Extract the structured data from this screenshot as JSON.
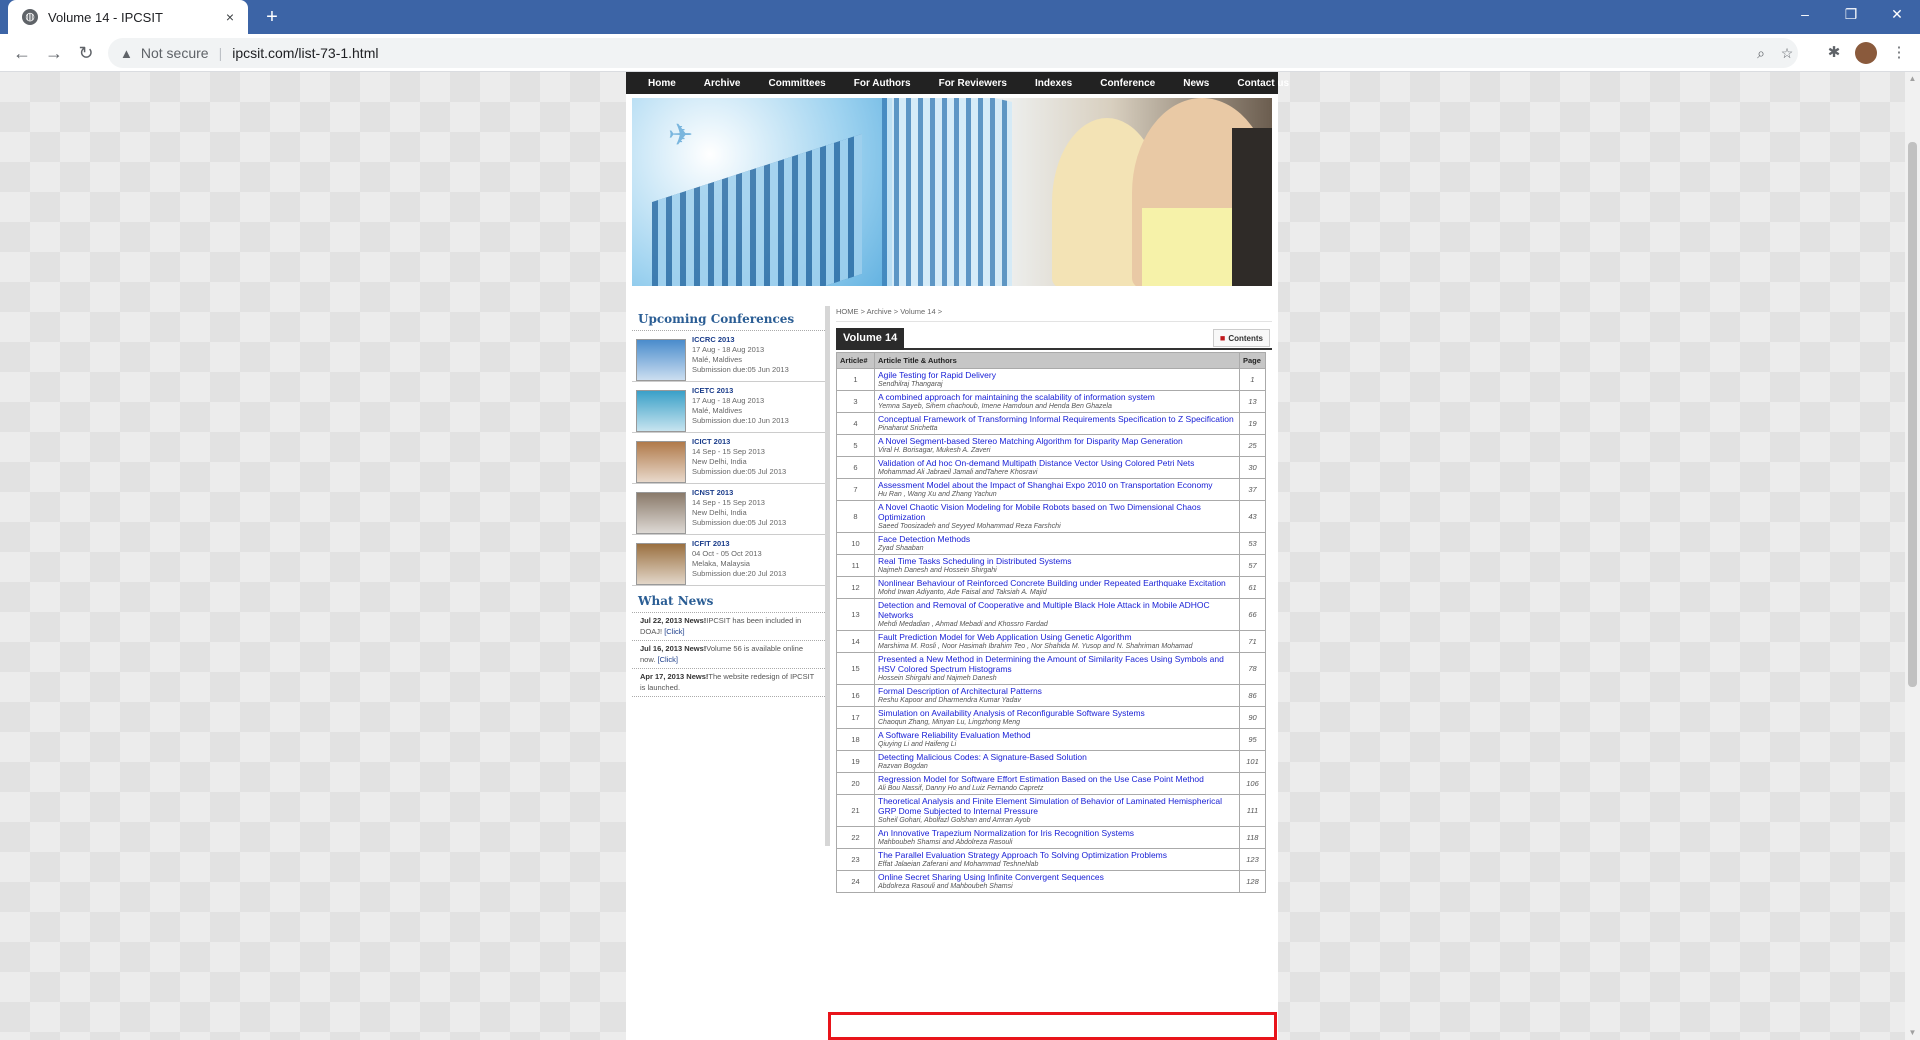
{
  "browser": {
    "tab_title": "Volume 14 - IPCSIT",
    "tab_close": "×",
    "new_tab": "+",
    "security_label": "Not secure",
    "url": "ipcsit.com/list-73-1.html",
    "window_controls": [
      "–",
      "❐",
      "✕"
    ]
  },
  "site": {
    "nav": [
      "Home",
      "Archive",
      "Committees",
      "For Authors",
      "For Reviewers",
      "Indexes",
      "Conference",
      "News",
      "Contact us"
    ]
  },
  "sidebar": {
    "upcoming_title": "Upcoming Conferences",
    "conferences": [
      {
        "name": "ICCRC 2013",
        "dates": "17 Aug - 18 Aug 2013",
        "location": "Malé, Maldives",
        "due": "Submission due:05 Jun 2013",
        "thumb_color": "#4a8ccc"
      },
      {
        "name": "ICETC 2013",
        "dates": "17 Aug - 18 Aug 2013",
        "location": "Malé, Maldives",
        "due": "Submission due:10 Jun 2013",
        "thumb_color": "#3aa0c8"
      },
      {
        "name": "ICICT 2013",
        "dates": "14 Sep - 15 Sep 2013",
        "location": "New Delhi, India",
        "due": "Submission due:05 Jul 2013",
        "thumb_color": "#b07a4a"
      },
      {
        "name": "ICNST 2013",
        "dates": "14 Sep - 15 Sep 2013",
        "location": "New Delhi, India",
        "due": "Submission due:05 Jul 2013",
        "thumb_color": "#8a7a6a"
      },
      {
        "name": "ICFIT 2013",
        "dates": "04 Oct - 05 Oct 2013",
        "location": "Melaka, Malaysia",
        "due": "Submission due:20 Jul 2013",
        "thumb_color": "#9a7040"
      }
    ],
    "news_title": "What News",
    "news": [
      {
        "date": "Jul 22, 2013 News!",
        "text": "IPCSIT has been included in DOAJ!",
        "link": "[Click]"
      },
      {
        "date": "Jul 16, 2013 News!",
        "text": "Volume 56 is available online now.",
        "link": "[Click]"
      },
      {
        "date": "Apr 17, 2013 News!",
        "text": "The website redesign of IPCSIT is launched.",
        "link": ""
      }
    ]
  },
  "main": {
    "breadcrumb": "HOME > Archive > Volume 14 >",
    "volume_title": "Volume 14",
    "contents_label": "Contents",
    "table_headers": {
      "num": "Article#",
      "title": "Article Title & Authors",
      "page": "Page"
    },
    "articles": [
      {
        "num": "1",
        "title": "Agile Testing for Rapid Delivery",
        "authors": "Sendhilraj Thangaraj",
        "page": "1"
      },
      {
        "num": "3",
        "title": "A combined approach for maintaining the scalability of information system",
        "authors": "Yemna Sayeb, Sihem chachoub, Imene Hamdoun and Henda Ben Ghazela",
        "page": "13"
      },
      {
        "num": "4",
        "title": "Conceptual Framework of Transforming Informal Requirements Specification to Z Specification",
        "authors": "Pinaharut Srichetta",
        "page": "19"
      },
      {
        "num": "5",
        "title": "A Novel Segment-based Stereo Matching Algorithm for Disparity Map Generation",
        "authors": "Viral H. Borisagar, Mukesh A. Zaveri",
        "page": "25"
      },
      {
        "num": "6",
        "title": "Validation of Ad hoc On-demand Multipath Distance Vector Using Colored Petri Nets",
        "authors": "Mohammad Ali Jabraeil Jamali andTahere Khosravi",
        "page": "30"
      },
      {
        "num": "7",
        "title": "Assessment Model about the Impact of Shanghai Expo 2010 on Transportation Economy",
        "authors": "Hu Ran , Wang Xu and Zhang Yachun",
        "page": "37"
      },
      {
        "num": "8",
        "title": "A Novel Chaotic Vision Modeling for Mobile Robots based on Two Dimensional Chaos Optimization",
        "authors": "Saeed Toosizadeh and Seyyed Mohammad Reza Farshchi",
        "page": "43"
      },
      {
        "num": "10",
        "title": "Face Detection Methods",
        "authors": "Zyad Shaaban",
        "page": "53"
      },
      {
        "num": "11",
        "title": "Real Time Tasks Scheduling in Distributed Systems",
        "authors": "Najmeh Danesh and Hossein Shirgahi",
        "page": "57"
      },
      {
        "num": "12",
        "title": "Nonlinear Behaviour of Reinforced Concrete Building under Repeated Earthquake Excitation",
        "authors": "Mohd Irwan Adiyanto, Ade Faisal and Taksiah A. Majid",
        "page": "61"
      },
      {
        "num": "13",
        "title": "Detection and Removal of Cooperative and Multiple Black Hole Attack in Mobile ADHOC Networks",
        "authors": "Mehdi Medadian , Ahmad Mebadi and Khossro Fardad",
        "page": "66"
      },
      {
        "num": "14",
        "title": "Fault Prediction Model for Web Application Using Genetic Algorithm",
        "authors": "Marshima M. Rosli , Noor Hasimah Ibrahim Teo , Nor Shahida M. Yusop and N. Shahriman Mohamad",
        "page": "71"
      },
      {
        "num": "15",
        "title": "Presented a New Method in Determining the Amount of Similarity Faces Using Symbols and HSV Colored Spectrum Histograms",
        "authors": "Hossein Shirgahi and Najmeh Danesh",
        "page": "78"
      },
      {
        "num": "16",
        "title": "Formal Description of Architectural Patterns",
        "authors": "Reshu Kapoor and Dharmendra Kumar Yadav",
        "page": "86"
      },
      {
        "num": "17",
        "title": "Simulation on Availability Analysis of Reconfigurable Software Systems",
        "authors": "Chaoqun Zhang, Minyan Lu, Lingzhong Meng",
        "page": "90"
      },
      {
        "num": "18",
        "title": "A Software Reliability Evaluation Method",
        "authors": "Qiuying Li and Haifeng Li",
        "page": "95"
      },
      {
        "num": "19",
        "title": "Detecting Malicious Codes: A Signature-Based Solution",
        "authors": "Razvan Bogdan",
        "page": "101"
      },
      {
        "num": "20",
        "title": "Regression Model for Software Effort Estimation Based on the Use Case Point Method",
        "authors": "Ali Bou Nassif, Danny Ho and Luiz Fernando Capretz",
        "page": "106"
      },
      {
        "num": "21",
        "title": "Theoretical Analysis and Finite Element Simulation of Behavior of Laminated Hemispherical GRP Dome Subjected to Internal Pressure",
        "authors": "Soheil Gohari, Abolfazl Golshan and Amran Ayob",
        "page": "111"
      },
      {
        "num": "22",
        "title": "An Innovative Trapezium Normalization for Iris Recognition Systems",
        "authors": "Mahboubeh Shamsi and Abdolreza Rasouli",
        "page": "118"
      },
      {
        "num": "23",
        "title": "The Parallel Evaluation Strategy Approach To Solving Optimization Problems",
        "authors": "Effat Jalaeian Zaferani and Mohammad Teshnehlab",
        "page": "123"
      },
      {
        "num": "24",
        "title": "Online Secret Sharing Using Infinite Convergent Sequences",
        "authors": "Abdolreza Rasouli and Mahboubeh Shamsi",
        "page": "128"
      }
    ]
  },
  "colors": {
    "accent_nav": "#222222",
    "link": "#1a21d6",
    "highlight": "#e8141a",
    "chrome": "#3c64a6"
  },
  "icons": [
    "globe-icon",
    "back-icon",
    "forward-icon",
    "reload-icon",
    "warning-icon",
    "zoom-icon",
    "star-icon",
    "extensions-icon",
    "menu-icon",
    "pdf-icon",
    "airplane-icon"
  ]
}
